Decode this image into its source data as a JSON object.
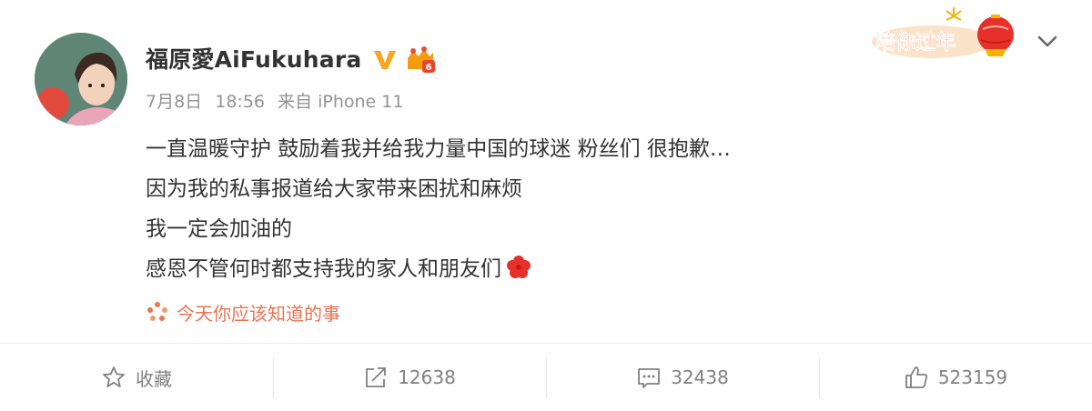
{
  "post": {
    "username": "福原愛AiFukuhara",
    "meta": {
      "date": "7月8日",
      "time": "18:56",
      "source": "来自 iPhone 11"
    },
    "lines": [
      "一直温暖守护 鼓励着我并给我力量中国的球迷 粉丝们 很抱歉…",
      "因为我的私事报道给大家带来困扰和麻烦",
      "我一定会加油的",
      "感恩不管何时都支持我的家人和朋友们"
    ],
    "topic": "今天你应该知道的事",
    "promo_text": "陪你过年"
  },
  "actions": {
    "favorite": "收藏",
    "repost": "12638",
    "comment": "32438",
    "like": "523159"
  },
  "colors": {
    "accent": "#eb7350",
    "verified": "#f5a623",
    "text": "#333333",
    "muted": "#939393"
  },
  "icons": [
    "verified-v-icon",
    "level-badge-icon",
    "red-flower-emoji",
    "topic-icon",
    "chevron-down-icon",
    "star-icon",
    "repost-icon",
    "comment-icon",
    "like-icon"
  ]
}
